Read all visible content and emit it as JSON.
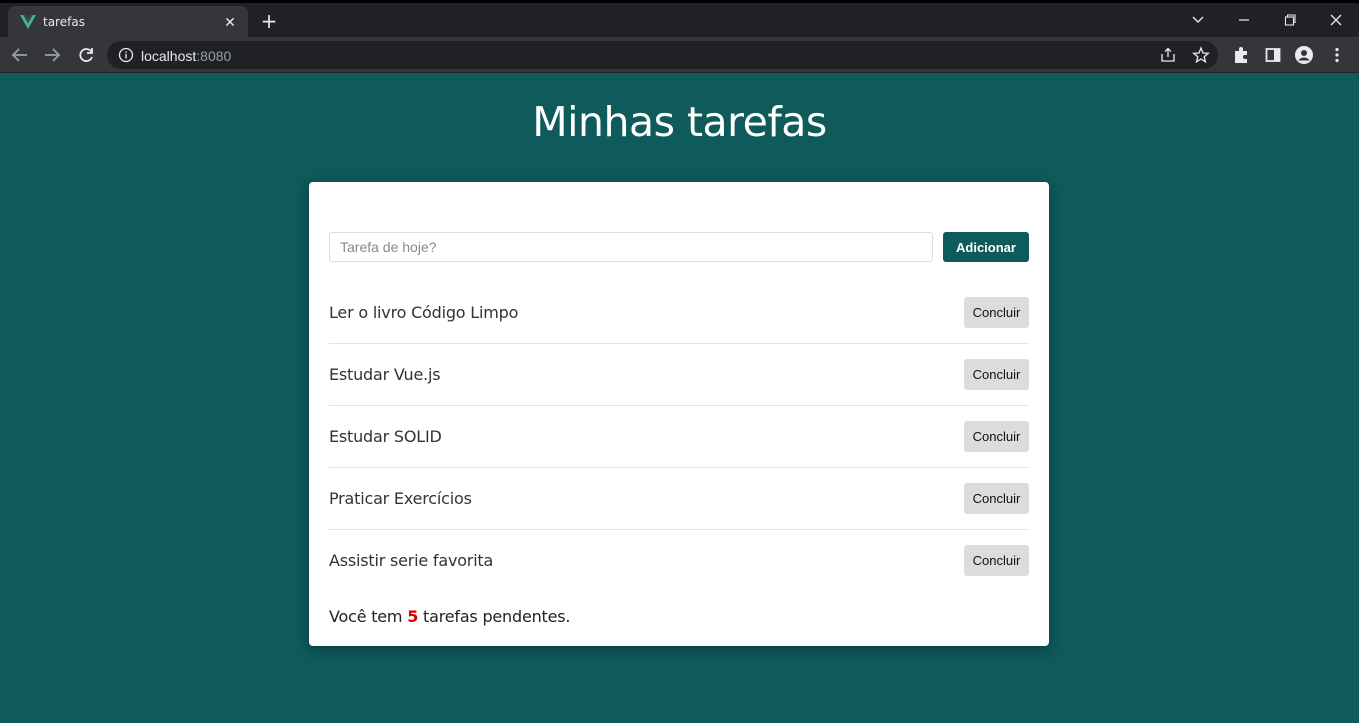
{
  "browser": {
    "tab_title": "tarefas",
    "tab_close": "✕",
    "new_tab": "+",
    "url_host": "localhost",
    "url_port": ":8080",
    "icons": [
      "vue-logo-icon",
      "close-icon",
      "plus-icon",
      "chevron-down-icon",
      "minimize-icon",
      "restore-icon",
      "close-window-icon",
      "back-icon",
      "forward-icon",
      "reload-icon",
      "info-icon",
      "share-icon",
      "star-icon",
      "extensions-icon",
      "side-panel-icon",
      "profile-icon",
      "menu-icon"
    ]
  },
  "page": {
    "title": "Minhas tarefas",
    "input_placeholder": "Tarefa de hoje?",
    "input_value": "",
    "add_label": "Adicionar"
  },
  "tasks": [
    {
      "label": "Ler o livro Código Limpo",
      "action": "Concluir"
    },
    {
      "label": "Estudar Vue.js",
      "action": "Concluir"
    },
    {
      "label": "Estudar SOLID",
      "action": "Concluir"
    },
    {
      "label": "Praticar Exercícios",
      "action": "Concluir"
    },
    {
      "label": "Assistir serie favorita",
      "action": "Concluir"
    }
  ],
  "summary": {
    "prefix": "Você tem ",
    "count": "5",
    "suffix": " tarefas pendentes."
  },
  "colors": {
    "background": "#0f5a5a",
    "accent": "#0f5a5a",
    "count": "#e00000"
  }
}
